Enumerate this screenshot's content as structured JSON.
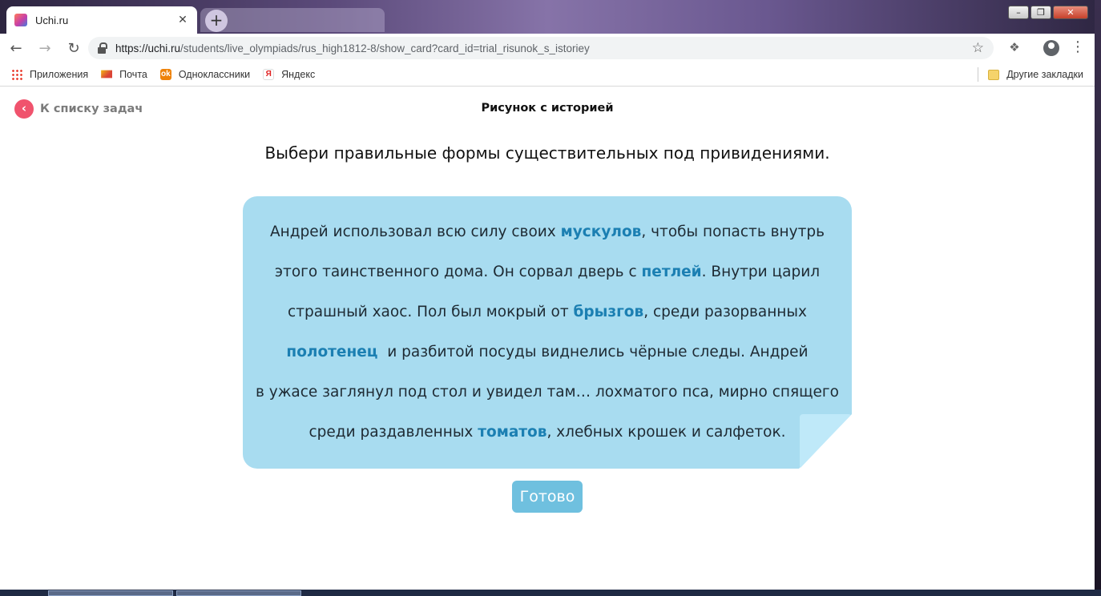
{
  "browser": {
    "tab_title": "Uchi.ru",
    "tab_close": "✕",
    "new_tab": "+",
    "url_host": "https://uchi.ru",
    "url_path": "/students/live_olympiads/rus_high1812-8/show_card?card_id=trial_risunok_s_istoriey",
    "window_controls": {
      "minimize": "–",
      "maximize": "❐",
      "close": "✕"
    }
  },
  "bookmarks": {
    "items": [
      {
        "label": "Приложения",
        "icon": "apps-icon"
      },
      {
        "label": "Почта",
        "icon": "mail-icon"
      },
      {
        "label": "Одноклассники",
        "icon": "odnoklassniki-icon"
      },
      {
        "label": "Яндекс",
        "icon": "yandex-icon"
      }
    ],
    "other": "Другие закладки"
  },
  "page": {
    "back_label": "К списку задач",
    "title": "Рисунок с историей",
    "instruction": "Выбери правильные формы существительных под привидениями.",
    "story": {
      "line1_a": "Андрей использовал всю силу своих ",
      "line1_hl": "мускулов",
      "line1_b": ", чтобы попасть внутрь",
      "line2_a": "этого таинственного дома. Он сорвал дверь с ",
      "line2_hl": "петлей",
      "line2_b": ". Внутри царил",
      "line3_a": "страшный хаос. Пол был мокрый от ",
      "line3_hl": "брызгов",
      "line3_b": ", среди разорванных",
      "line4_hl": "полотенец",
      "line4_b": "  и разбитой посуды виднелись чёрные следы. Андрей",
      "line5": "в ужасе заглянул под стол и увидел там… лохматого пса, мирно спящего",
      "line6_a": "среди раздавленных ",
      "line6_hl": "томатов",
      "line6_b": ", хлебных крошек и салфеток."
    },
    "done_button": "Готово"
  },
  "colors": {
    "card": "#a8dcf0",
    "highlight": "#1b7fb2",
    "button": "#6fc0df",
    "back_circle": "#f0536d"
  }
}
